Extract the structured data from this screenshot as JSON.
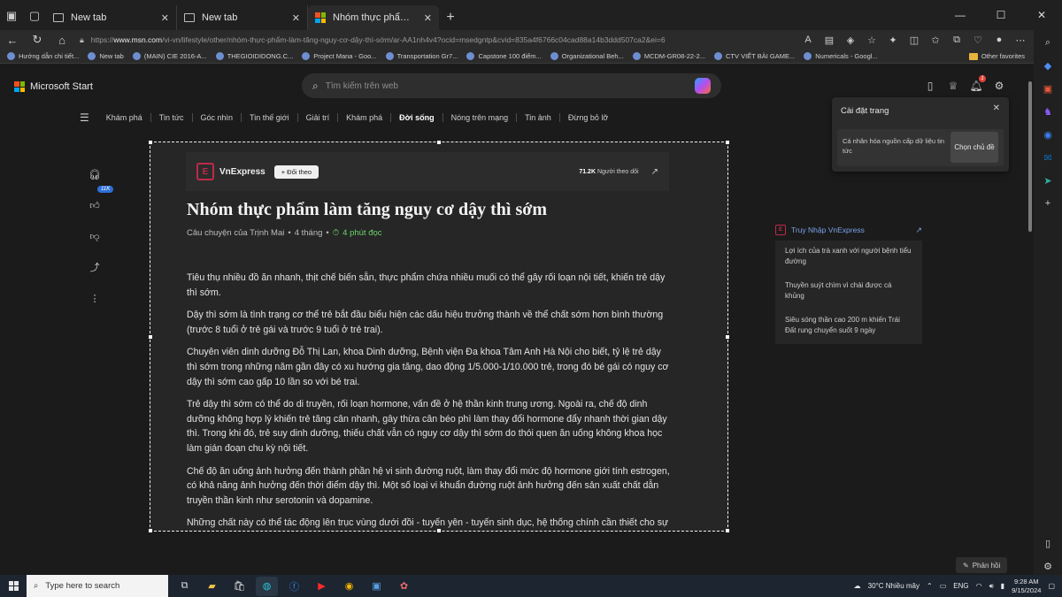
{
  "browser": {
    "tabs": [
      {
        "title": "New tab",
        "active": false
      },
      {
        "title": "New tab",
        "active": false
      },
      {
        "title": "Nhóm thực phẩm làm tăng nguy",
        "active": true
      }
    ],
    "url_prefix": "https://",
    "url_host": "www.msn.com",
    "url_path": "/vi-vn/lifestyle/other/nhóm-thực-phẩm-làm-tăng-nguy-cơ-dậy-thì-sớm/ar-AA1nh4v4?ocid=msedgntp&cvid=835a4f6766c04cad88a14b3ddd507ca2&ei=6",
    "bookmarks": [
      "Hướng dẫn chi tiết...",
      "New tab",
      "(MAIN) CIE 2016-A...",
      "THEGIOIDIDONG.C...",
      "Project Mana - Goo...",
      "Transportation Gr7...",
      "Capstone 100 điểm...",
      "Organizational Beh...",
      "MCDM-GR08-22-2...",
      "CTV VIẾT BÀI GAME...",
      "Numericals - Googl..."
    ],
    "other_favorites": "Other favorites"
  },
  "msn": {
    "brand": "Microsoft Start",
    "search_placeholder": "Tìm kiếm trên web",
    "notification_count": "1",
    "nav": [
      "Khám phá",
      "Tin tức",
      "Góc nhìn",
      "Tin thế giới",
      "Giải trí",
      "Khám phá",
      "Đời sống",
      "Nóng trên mạng",
      "Tin ảnh",
      "Đừng bỏ lỡ"
    ],
    "nav_active_index": 6,
    "like_count": "11K"
  },
  "article": {
    "publisher": "VnExpress",
    "follow_label": "+ Đối theo",
    "followers_count": "71.2K",
    "followers_label": "Người theo dõi",
    "title": "Nhóm thực phẩm làm tăng nguy cơ dậy thì sớm",
    "byline": "Câu chuyện của Trịnh Mai",
    "age": "4 tháng",
    "read_time": "4 phút đọc",
    "paragraphs": [
      "Tiêu thụ nhiều đồ ăn nhanh, thịt chế biến sẵn, thực phẩm chứa nhiều muối có thể gây rối loạn nội tiết, khiến trẻ dậy thì sớm.",
      "Dậy thì sớm là tình trạng cơ thể trẻ bắt đầu biểu hiện các dấu hiệu trưởng thành về thể chất sớm hơn bình thường (trước 8 tuổi ở trẻ gái và trước 9 tuổi ở trẻ trai).",
      "Chuyên viên dinh dưỡng Đỗ Thị Lan, khoa Dinh dưỡng, Bệnh viện Đa khoa Tâm Anh Hà Nội cho biết, tỷ lệ trẻ dậy thì sớm trong những năm gần đây có xu hướng gia tăng, dao động 1/5.000-1/10.000 trẻ, trong đó bé gái có nguy cơ dậy thì sớm cao gấp 10 lần so với bé trai.",
      "Trẻ dậy thì sớm có thể do di truyền, rối loạn hormone, vấn đề ở hệ thần kinh trung ương. Ngoài ra, chế độ dinh dưỡng không hợp lý khiến trẻ tăng cân nhanh, gây thừa cân béo phì làm thay đổi hormone đẩy nhanh thời gian dậy thì. Trong khi đó, trẻ suy dinh dưỡng, thiếu chất vẫn có nguy cơ dậy thì sớm do thói quen ăn uống không khoa học làm gián đoạn chu kỳ nội tiết.",
      "Chế độ ăn uống ảnh hưởng đến thành phần hệ vi sinh đường ruột, làm thay đổi mức độ hormone giới tính estrogen, có khả năng ảnh hưởng đến thời điểm dậy thì. Một số loại vi khuẩn đường ruột ảnh hưởng đến sản xuất chất dẫn truyền thần kinh như serotonin và dopamine.",
      "Những chất này có thể tác động lên trục vùng dưới đồi - tuyến yên - tuyến sinh dục, hệ thống chính cần thiết cho sự phát triển tuổi dậy thì."
    ]
  },
  "settings_popup": {
    "title": "Cài đặt trang",
    "description": "Cá nhân hóa nguồn cấp dữ liệu tin tức",
    "button": "Chọn chủ đề"
  },
  "related": {
    "heading": "Truy Nhập VnExpress",
    "items": [
      "Lợi ích của trà xanh với người bệnh tiểu đường",
      "Thuyền suýt chìm vì chài được cá khủng",
      "Siêu sóng thần cao 200 m khiến Trái Đất rung chuyển suốt 9 ngày"
    ]
  },
  "feedback_label": "Phản hồi",
  "taskbar": {
    "search_placeholder": "Type here to search",
    "weather": "30°C  Nhiều mây",
    "language": "ENG",
    "time": "9:28 AM",
    "date": "9/15/2024"
  }
}
